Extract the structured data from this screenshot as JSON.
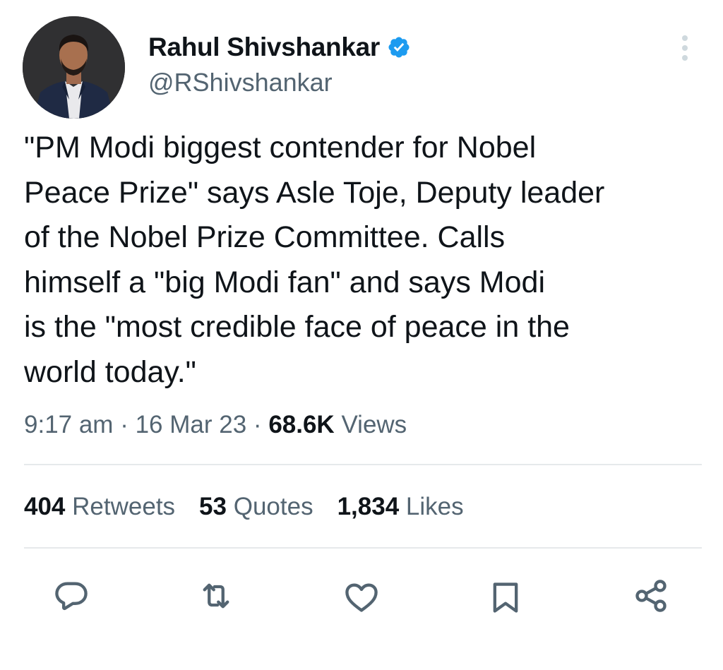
{
  "author": {
    "display_name": "Rahul Shivshankar",
    "handle": "@RShivshankar",
    "verified": true,
    "verified_color": "#1d9bf0"
  },
  "tweet": {
    "lines": [
      "\"PM Modi biggest contender for Nobel",
      "Peace Prize\" says Asle Toje, Deputy leader",
      "of the Nobel Prize Committee. Calls",
      "himself a \"big Modi fan\" and says Modi",
      "is the \"most credible face of peace in the",
      "world today.\""
    ]
  },
  "meta": {
    "time": "9:17 am",
    "separator": "·",
    "date": "16 Mar 23",
    "views_count": "68.6K",
    "views_label": "Views"
  },
  "stats": {
    "retweets": {
      "count": "404",
      "label": "Retweets"
    },
    "quotes": {
      "count": "53",
      "label": "Quotes"
    },
    "likes": {
      "count": "1,834",
      "label": "Likes"
    }
  },
  "actions": {
    "icons": [
      "reply-icon",
      "retweet-icon",
      "like-icon",
      "bookmark-icon",
      "share-icon"
    ],
    "icon_color": "#536471"
  }
}
